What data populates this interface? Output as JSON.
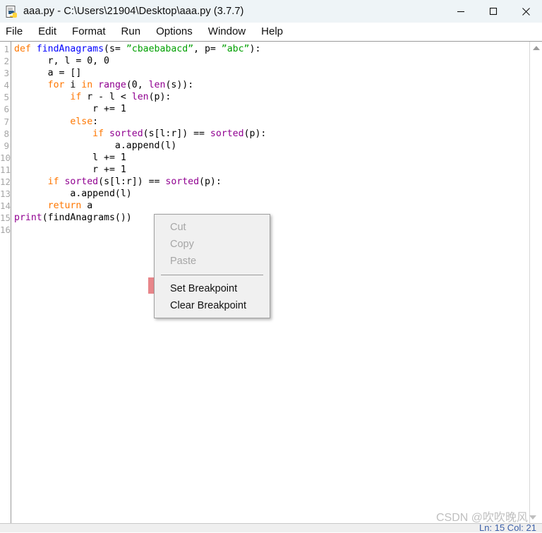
{
  "window": {
    "title": "aaa.py - C:\\Users\\21904\\Desktop\\aaa.py (3.7.7)",
    "icon": "python-file-icon",
    "controls": {
      "minimize": "minimize-icon",
      "maximize": "maximize-icon",
      "close": "close-icon"
    }
  },
  "menubar": {
    "items": [
      {
        "label": "File"
      },
      {
        "label": "Edit"
      },
      {
        "label": "Format"
      },
      {
        "label": "Run"
      },
      {
        "label": "Options"
      },
      {
        "label": "Window"
      },
      {
        "label": "Help"
      }
    ]
  },
  "editor": {
    "line_numbers": [
      "1",
      "2",
      "3",
      "4",
      "5",
      "6",
      "7",
      "8",
      "9",
      "10",
      "11",
      "12",
      "13",
      "14",
      "15",
      "16"
    ],
    "lines": [
      [
        {
          "t": "def ",
          "c": "key"
        },
        {
          "t": "findAnagrams",
          "c": "def"
        },
        {
          "t": "(s= ",
          "c": "plain"
        },
        {
          "t": "”cbaebabacd”",
          "c": "str"
        },
        {
          "t": ", p= ",
          "c": "plain"
        },
        {
          "t": "”abc”",
          "c": "str"
        },
        {
          "t": "):",
          "c": "plain"
        }
      ],
      [
        {
          "t": "      r, l = 0, 0",
          "c": "plain"
        }
      ],
      [
        {
          "t": "      a = []",
          "c": "plain"
        }
      ],
      [
        {
          "t": "      ",
          "c": "plain"
        },
        {
          "t": "for",
          "c": "key"
        },
        {
          "t": " i ",
          "c": "plain"
        },
        {
          "t": "in",
          "c": "key"
        },
        {
          "t": " ",
          "c": "plain"
        },
        {
          "t": "range",
          "c": "bi"
        },
        {
          "t": "(0, ",
          "c": "plain"
        },
        {
          "t": "len",
          "c": "bi"
        },
        {
          "t": "(s)):",
          "c": "plain"
        }
      ],
      [
        {
          "t": "          ",
          "c": "plain"
        },
        {
          "t": "if",
          "c": "key"
        },
        {
          "t": " r - l < ",
          "c": "plain"
        },
        {
          "t": "len",
          "c": "bi"
        },
        {
          "t": "(p):",
          "c": "plain"
        }
      ],
      [
        {
          "t": "              r += 1",
          "c": "plain"
        }
      ],
      [
        {
          "t": "          ",
          "c": "plain"
        },
        {
          "t": "else",
          "c": "key"
        },
        {
          "t": ":",
          "c": "plain"
        }
      ],
      [
        {
          "t": "              ",
          "c": "plain"
        },
        {
          "t": "if",
          "c": "key"
        },
        {
          "t": " ",
          "c": "plain"
        },
        {
          "t": "sorted",
          "c": "bi"
        },
        {
          "t": "(s[l:r]) == ",
          "c": "plain"
        },
        {
          "t": "sorted",
          "c": "bi"
        },
        {
          "t": "(p):",
          "c": "plain"
        }
      ],
      [
        {
          "t": "                  a.append(l)",
          "c": "plain"
        }
      ],
      [
        {
          "t": "              l += 1",
          "c": "plain"
        }
      ],
      [
        {
          "t": "              r += 1",
          "c": "plain"
        }
      ],
      [
        {
          "t": "      ",
          "c": "plain"
        },
        {
          "t": "if",
          "c": "key"
        },
        {
          "t": " ",
          "c": "plain"
        },
        {
          "t": "sorted",
          "c": "bi"
        },
        {
          "t": "(s[l:r]) == ",
          "c": "plain"
        },
        {
          "t": "sorted",
          "c": "bi"
        },
        {
          "t": "(p):",
          "c": "plain"
        }
      ],
      [
        {
          "t": "          a.append(l)",
          "c": "plain"
        }
      ],
      [
        {
          "t": "      ",
          "c": "plain"
        },
        {
          "t": "return",
          "c": "key"
        },
        {
          "t": " a",
          "c": "plain"
        }
      ],
      [
        {
          "t": "print",
          "c": "bi"
        },
        {
          "t": "(findAnagrams())",
          "c": "plain"
        }
      ],
      []
    ]
  },
  "context_menu": {
    "items": [
      {
        "label": "Cut",
        "state": "disabled"
      },
      {
        "label": "Copy",
        "state": "disabled"
      },
      {
        "label": "Paste",
        "state": "disabled"
      },
      {
        "label": "Set Breakpoint",
        "state": "highlighted"
      },
      {
        "label": "Clear Breakpoint",
        "state": "normal"
      }
    ],
    "highlight_color": "#e8868a"
  },
  "scrollbar": {
    "up_arrow": "scroll-up-arrow-icon"
  },
  "statusbar": {
    "position": "Ln: 15  Col: 21"
  },
  "watermark": {
    "text": "CSDN @吹吹晚风"
  }
}
